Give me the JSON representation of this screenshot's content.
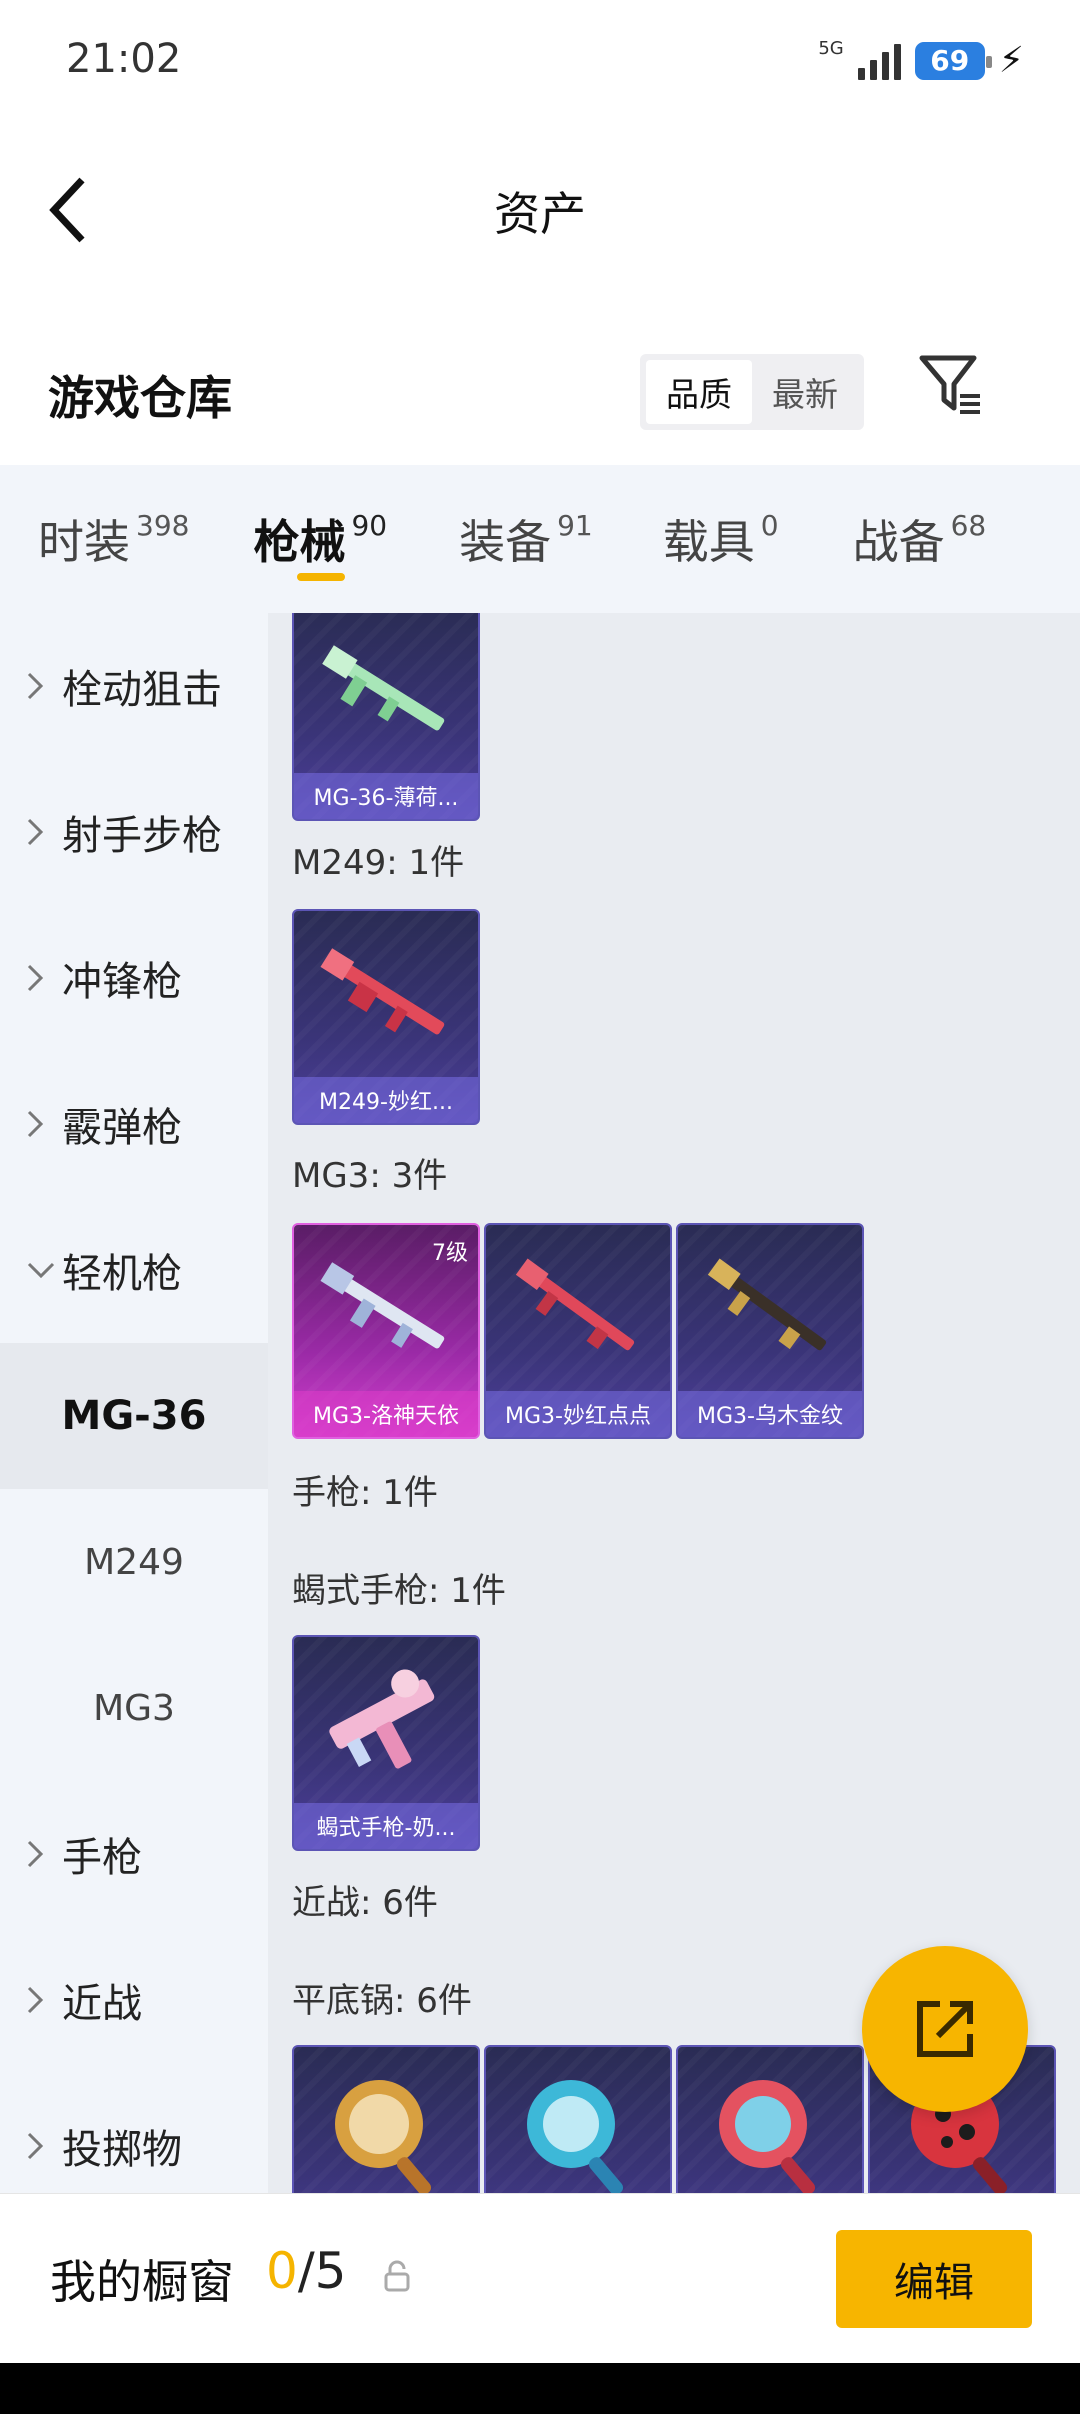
{
  "status_bar": {
    "time": "21:02",
    "network": "5G",
    "battery": "69"
  },
  "header": {
    "title": "资产"
  },
  "section": {
    "title": "游戏仓库",
    "sort_options": [
      "品质",
      "最新"
    ],
    "active_sort": "品质"
  },
  "tabs": [
    {
      "label": "时装",
      "count": "398"
    },
    {
      "label": "枪械",
      "count": "90",
      "active": true
    },
    {
      "label": "装备",
      "count": "91"
    },
    {
      "label": "载具",
      "count": "0"
    },
    {
      "label": "战备",
      "count": "68"
    }
  ],
  "sidebar": {
    "categories": [
      "栓动狙击",
      "射手步枪",
      "冲锋枪",
      "霰弹枪",
      "轻机枪"
    ],
    "expanded": "轻机枪",
    "subitems": [
      "MG-36",
      "M249",
      "MG3"
    ],
    "active_subitem": "MG-36",
    "more_categories": [
      "手枪",
      "近战",
      "投掷物"
    ]
  },
  "content": {
    "groups": [
      {
        "label": "",
        "cards": [
          {
            "name": "MG-36-薄荷..."
          }
        ]
      },
      {
        "label": "M249: 1件",
        "cards": [
          {
            "name": "M249-妙红..."
          }
        ]
      },
      {
        "label": "MG3: 3件",
        "cards": [
          {
            "name": "MG3-洛神天依",
            "level": "7级",
            "style": "pink"
          },
          {
            "name": "MG3-妙红点点"
          },
          {
            "name": "MG3-乌木金纹"
          }
        ]
      },
      {
        "label": "手枪: 1件",
        "cards": []
      },
      {
        "label": "蝎式手枪: 1件",
        "cards": [
          {
            "name": "蝎式手枪-奶..."
          }
        ]
      },
      {
        "label": "近战: 6件",
        "cards": []
      },
      {
        "label": "平底锅: 6件",
        "cards": [
          {
            "name": ""
          },
          {
            "name": ""
          },
          {
            "name": ""
          },
          {
            "name": ""
          }
        ]
      }
    ]
  },
  "bottom": {
    "showcase_label": "我的橱窗",
    "showcase_used": "0",
    "showcase_sep": "/",
    "showcase_total": "5",
    "edit_label": "编辑"
  },
  "colors": {
    "accent": "#f7b500",
    "card_purple": "#3a3478",
    "card_pink": "#d23fcf"
  },
  "icons": {
    "back": "chevron-left-icon",
    "filter": "filter-icon",
    "share": "share-icon",
    "lock": "lock-icon"
  }
}
